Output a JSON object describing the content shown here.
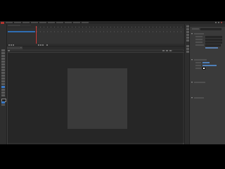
{
  "window": {
    "menu_items": [
      "",
      "",
      "",
      "",
      "",
      "",
      "",
      "",
      "",
      ""
    ],
    "colors": {
      "accent": "#3b78c2",
      "playhead": "#d23c3c",
      "stage": "#3a3a3a",
      "pasteboard": "#262626"
    }
  },
  "timeline": {
    "tab_labels": [
      "",
      ""
    ],
    "layer_name": ""
  },
  "document": {
    "tab_label": "",
    "close_glyph": "×",
    "scene_label": "",
    "zoom": ""
  },
  "properties": {
    "title": ""
  },
  "icons": {
    "tools": [
      "selection-tool-icon",
      "subselection-tool-icon",
      "free-transform-icon",
      "3d-rotation-icon",
      "lasso-icon",
      "pen-icon",
      "text-icon",
      "line-icon",
      "rectangle-icon",
      "oval-icon",
      "pencil-icon",
      "brush-icon",
      "paint-bucket-icon",
      "eyedropper-icon",
      "eraser-icon",
      "hand-icon",
      "zoom-icon",
      "stroke-color-icon",
      "fill-color-icon",
      "swap-colors-icon"
    ]
  }
}
